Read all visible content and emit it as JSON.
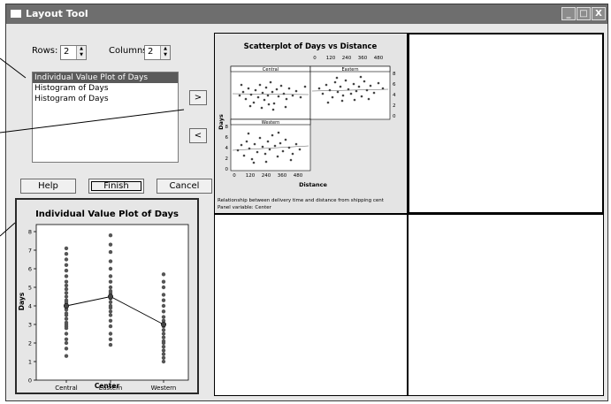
{
  "window": {
    "title": "Layout Tool",
    "buttons": [
      "_",
      "□",
      "X"
    ]
  },
  "controls": {
    "rows_label": "Rows:",
    "rows_value": "2",
    "columns_label": "Columns:",
    "columns_value": "2",
    "graph_list": [
      {
        "label": "Individual Value Plot of Days",
        "selected": true
      },
      {
        "label": "Histogram of Days",
        "selected": false
      },
      {
        "label": "Histogram of Days",
        "selected": false
      }
    ],
    "move_right_label": ">",
    "move_left_label": "<",
    "help_label": "Help",
    "finish_label": "Finish",
    "cancel_label": "Cancel"
  },
  "preview": {
    "title": "Individual Value Plot of Days",
    "xlabel": "Center",
    "ylabel": "Days"
  },
  "layout_grid": {
    "scatter": {
      "title": "Scatterplot of Days vs Distance",
      "xlabel": "Distance",
      "ylabel": "Days",
      "panels": [
        "Central",
        "Eastern",
        "Western"
      ],
      "footnote_1": "Relationship between delivery time and distance from shipping cent",
      "footnote_2": "Panel variable: Center",
      "x_ticks": [
        "0",
        "120",
        "240",
        "360",
        "480"
      ],
      "y_ticks": [
        "0",
        "2",
        "4",
        "6",
        "8"
      ]
    }
  },
  "chart_data": [
    {
      "type": "scatter",
      "title": "Individual Value Plot of Days",
      "xlabel": "Center",
      "ylabel": "Days",
      "categories": [
        "Central",
        "Eastern",
        "Western"
      ],
      "ylim": [
        0,
        8
      ],
      "yticks": [
        0,
        1,
        2,
        3,
        4,
        5,
        6,
        7,
        8
      ],
      "points": {
        "Central": [
          1.3,
          1.7,
          2.0,
          2.2,
          2.5,
          2.8,
          2.9,
          3.0,
          3.1,
          3.3,
          3.5,
          3.6,
          3.8,
          3.9,
          4.0,
          4.1,
          4.2,
          4.3,
          4.5,
          4.7,
          4.9,
          5.1,
          5.3,
          5.6,
          5.9,
          6.2,
          6.5,
          6.8,
          7.1
        ],
        "Eastern": [
          1.9,
          2.2,
          2.5,
          2.9,
          3.2,
          3.5,
          3.7,
          3.9,
          4.0,
          4.2,
          4.4,
          4.6,
          4.7,
          4.8,
          5.0,
          5.3,
          5.6,
          6.0,
          6.4,
          6.9,
          7.3,
          7.8
        ],
        "Western": [
          1.0,
          1.2,
          1.4,
          1.6,
          1.8,
          2.0,
          2.1,
          2.3,
          2.5,
          2.7,
          2.9,
          3.0,
          3.2,
          3.4,
          3.7,
          4.0,
          4.3,
          4.6,
          5.0,
          5.3,
          5.7
        ]
      },
      "means": [
        4.0,
        4.5,
        3.0
      ]
    }
  ]
}
